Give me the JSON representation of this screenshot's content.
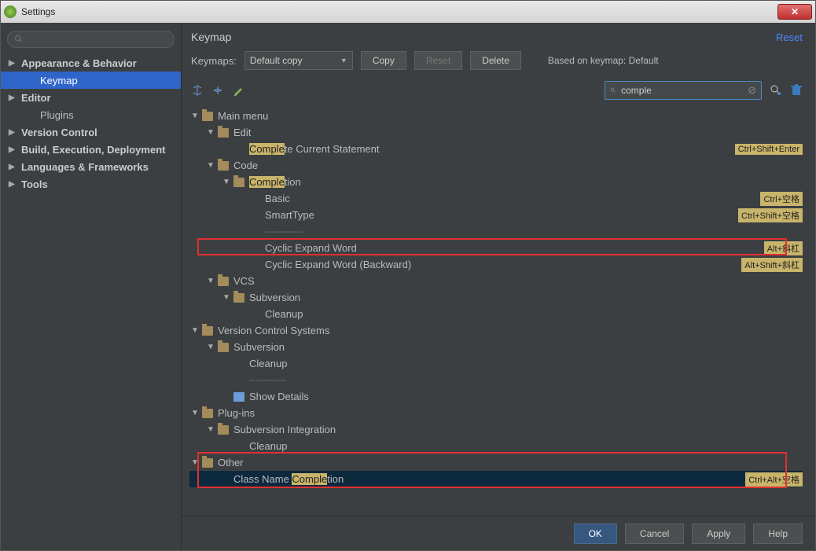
{
  "window": {
    "title": "Settings"
  },
  "sidebar": {
    "items": [
      {
        "label": "Appearance & Behavior",
        "bold": true,
        "arrow": true
      },
      {
        "label": "Keymap",
        "child": true,
        "selected": true
      },
      {
        "label": "Editor",
        "bold": true,
        "arrow": true
      },
      {
        "label": "Plugins",
        "child": true
      },
      {
        "label": "Version Control",
        "bold": true,
        "arrow": true
      },
      {
        "label": "Build, Execution, Deployment",
        "bold": true,
        "arrow": true
      },
      {
        "label": "Languages & Frameworks",
        "bold": true,
        "arrow": true
      },
      {
        "label": "Tools",
        "bold": true,
        "arrow": true
      }
    ]
  },
  "header": {
    "title": "Keymap",
    "reset": "Reset"
  },
  "keymaps": {
    "label": "Keymaps:",
    "value": "Default copy",
    "copy": "Copy",
    "reset": "Reset",
    "delete": "Delete",
    "based": "Based on keymap: Default"
  },
  "search": {
    "value": "comple"
  },
  "tree": {
    "rows": [
      {
        "ind": 0,
        "arrow": "▼",
        "folder": true,
        "text": "Main menu"
      },
      {
        "ind": 1,
        "arrow": "▼",
        "folder": true,
        "text": "Edit"
      },
      {
        "ind": 2,
        "pre": "",
        "hl": "Comple",
        "post": "te Current Statement",
        "short": "Ctrl+Shift+Enter"
      },
      {
        "ind": 1,
        "arrow": "▼",
        "folder": true,
        "text": "Code"
      },
      {
        "ind": 2,
        "arrow": "▼",
        "folder": true,
        "pre": "",
        "hl": "Comple",
        "post": "tion"
      },
      {
        "ind": 3,
        "text": "Basic",
        "short": "Ctrl+空格"
      },
      {
        "ind": 3,
        "text": "SmartType",
        "short": "Ctrl+Shift+空格"
      },
      {
        "ind": 3,
        "sep": "-------------"
      },
      {
        "ind": 3,
        "text": "Cyclic Expand Word",
        "short": "Alt+斜杠"
      },
      {
        "ind": 3,
        "text": "Cyclic Expand Word (Backward)",
        "short": "Alt+Shift+斜杠"
      },
      {
        "ind": 1,
        "arrow": "▼",
        "folder": true,
        "text": "VCS"
      },
      {
        "ind": 2,
        "arrow": "▼",
        "folder": true,
        "text": "Subversion"
      },
      {
        "ind": 3,
        "text": "Cleanup"
      },
      {
        "ind": 0,
        "arrow": "▼",
        "folder": true,
        "text": "Version Control Systems"
      },
      {
        "ind": 1,
        "arrow": "▼",
        "folder": true,
        "text": "Subversion"
      },
      {
        "ind": 2,
        "text": "Cleanup"
      },
      {
        "ind": 2,
        "sep": "-------------"
      },
      {
        "ind": 2,
        "icon": "detail",
        "text": "Show Details"
      },
      {
        "ind": 0,
        "arrow": "▼",
        "folder": true,
        "text": "Plug-ins"
      },
      {
        "ind": 1,
        "arrow": "▼",
        "folder": true,
        "text": "Subversion Integration"
      },
      {
        "ind": 2,
        "text": "Cleanup"
      },
      {
        "ind": 0,
        "arrow": "▼",
        "folder": true,
        "text": "Other"
      },
      {
        "ind": 1,
        "pre": "Class Name ",
        "hl": "Comple",
        "post": "tion",
        "short": "Ctrl+Alt+空格",
        "selected": true
      }
    ]
  },
  "footer": {
    "ok": "OK",
    "cancel": "Cancel",
    "apply": "Apply",
    "help": "Help"
  }
}
